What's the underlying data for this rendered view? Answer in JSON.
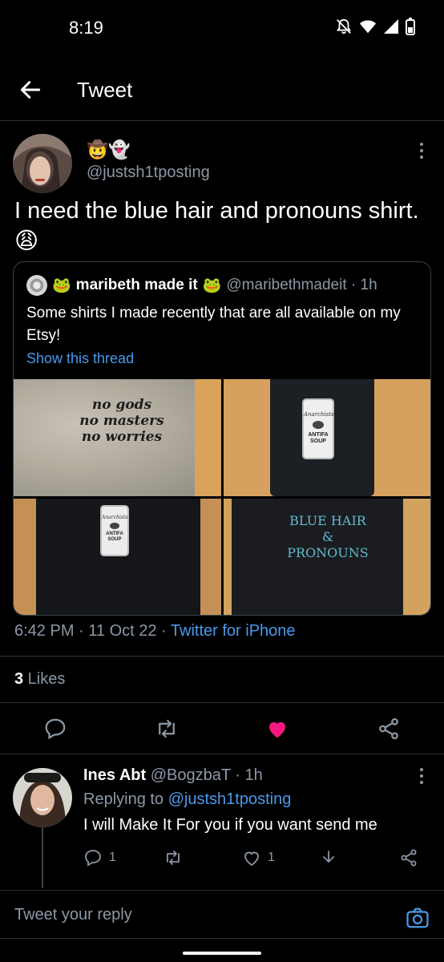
{
  "status_bar": {
    "time": "8:19"
  },
  "header": {
    "title": "Tweet"
  },
  "tweet": {
    "name_emojis": "🤠👻",
    "handle": "@justsh1tposting",
    "text": "I need the blue hair and pronouns shirt.",
    "text_emoji": "😩",
    "timestamp": "6:42 PM · 11 Oct 22 · ",
    "source": "Twitter for iPhone",
    "likes_count": "3",
    "likes_label": " Likes"
  },
  "quote": {
    "name_emoji_pre": "🐸",
    "name": "maribeth made it",
    "name_emoji_post": "🐸",
    "handle": "@maribethmadeit · 1h",
    "text": "Some shirts I made recently that are all available on my Etsy!",
    "show_thread": "Show this thread",
    "shirt1": [
      "no gods",
      "no masters",
      "no worries"
    ],
    "can_label": "Anarchists",
    "can_text": [
      "ANTIFA",
      "SOUP"
    ],
    "shirt4": [
      "BLUE HAIR",
      "&",
      "PRONOUNS"
    ]
  },
  "reply": {
    "name": "Ines Abt",
    "handle": "@BogzbaT · 1h",
    "replying_prefix": "Replying to ",
    "replying_to": "@justsh1tposting",
    "text": "I will Make It For you if you want send me",
    "reply_count": "1",
    "like_count": "1"
  },
  "composer": {
    "placeholder": "Tweet your reply"
  },
  "colors": {
    "accent": "#4a99e9",
    "like": "#f91880",
    "muted": "#8b98a5"
  }
}
